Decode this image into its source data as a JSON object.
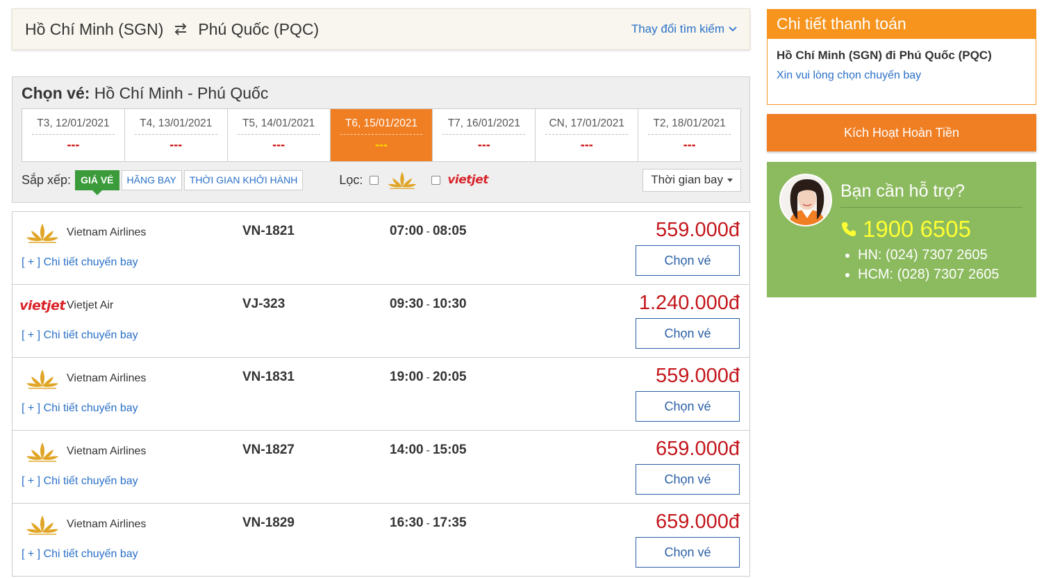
{
  "search": {
    "origin": "Hồ Chí Minh (SGN)",
    "destination": "Phú Quốc (PQC)",
    "change_label": "Thay đổi tìm kiếm"
  },
  "choose": {
    "title_bold": "Chọn vé:",
    "title_route": "Hồ Chí Minh - Phú Quốc"
  },
  "dates": [
    {
      "label": "T3, 12/01/2021",
      "price": "---"
    },
    {
      "label": "T4, 13/01/2021",
      "price": "---"
    },
    {
      "label": "T5, 14/01/2021",
      "price": "---"
    },
    {
      "label": "T6, 15/01/2021",
      "price": "---",
      "active": true
    },
    {
      "label": "T7, 16/01/2021",
      "price": "---"
    },
    {
      "label": "CN, 17/01/2021",
      "price": "---"
    },
    {
      "label": "T2, 18/01/2021",
      "price": "---"
    }
  ],
  "sort": {
    "label": "Sắp xếp:",
    "options": [
      "GIÁ VÉ",
      "HÃNG BAY",
      "THỜI GIAN KHỞI HÀNH"
    ],
    "active_index": 0
  },
  "filter": {
    "label": "Lọc:",
    "vietjet_logo_text": "vietjet"
  },
  "time_select": {
    "value": "Thời gian bay"
  },
  "flights": [
    {
      "airline": "Vietnam Airlines",
      "logo": "vietnam-airlines",
      "code": "VN-1821",
      "depart": "07:00",
      "arrive": "08:05",
      "price": "559.000đ",
      "detail": "[ + ] Chi tiết chuyến bay",
      "button": "Chọn vé"
    },
    {
      "airline": "Vietjet Air",
      "logo": "vietjet",
      "logo_text": "vietjet",
      "code": "VJ-323",
      "depart": "09:30",
      "arrive": "10:30",
      "price": "1.240.000đ",
      "detail": "[ + ] Chi tiết chuyến bay",
      "button": "Chọn vé"
    },
    {
      "airline": "Vietnam Airlines",
      "logo": "vietnam-airlines",
      "code": "VN-1831",
      "depart": "19:00",
      "arrive": "20:05",
      "price": "559.000đ",
      "detail": "[ + ] Chi tiết chuyến bay",
      "button": "Chọn vé"
    },
    {
      "airline": "Vietnam Airlines",
      "logo": "vietnam-airlines",
      "code": "VN-1827",
      "depart": "14:00",
      "arrive": "15:05",
      "price": "659.000đ",
      "detail": "[ + ] Chi tiết chuyến bay",
      "button": "Chọn vé"
    },
    {
      "airline": "Vietnam Airlines",
      "logo": "vietnam-airlines",
      "code": "VN-1829",
      "depart": "16:30",
      "arrive": "17:35",
      "price": "659.000đ",
      "detail": "[ + ] Chi tiết chuyến bay",
      "button": "Chọn vé"
    }
  ],
  "payment": {
    "title": "Chi tiết thanh toán",
    "route": "Hồ Chí Minh (SGN) đi Phú Quốc (PQC)",
    "note": "Xin vui lòng chọn chuyến bay"
  },
  "refund_button": "Kích Hoạt Hoàn Tiền",
  "support": {
    "title": "Bạn cần hỗ trợ?",
    "hotline": "1900 6505",
    "lines": [
      "HN: (024) 7307 2605",
      "HCM: (028) 7307 2605"
    ]
  },
  "colors": {
    "accent_orange": "#f07e23",
    "payment_orange": "#f7941d",
    "price_red": "#c4161c",
    "link_blue": "#2a70c8",
    "support_green": "#8cba5f",
    "hotline_yellow": "#ffff33",
    "sort_active_green": "#3b9b3b"
  },
  "icons": {
    "swap": "swap-arrows-icon",
    "chevron": "chevron-down-icon",
    "phone": "phone-icon"
  }
}
